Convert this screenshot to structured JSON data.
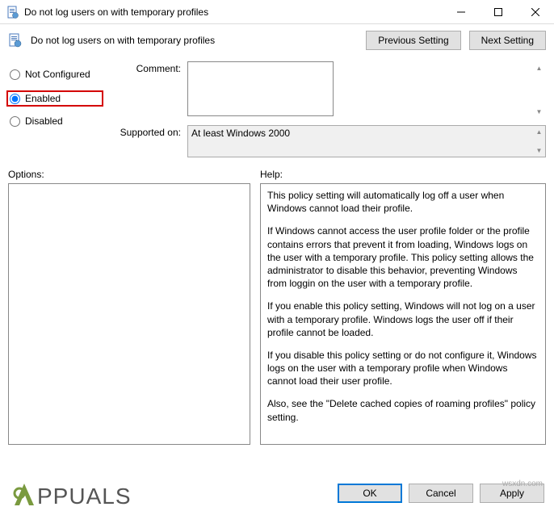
{
  "window": {
    "title": "Do not log users on with temporary profiles"
  },
  "header": {
    "policy_title": "Do not log users on with temporary profiles",
    "previous": "Previous Setting",
    "next": "Next Setting"
  },
  "radios": {
    "not_configured": "Not Configured",
    "enabled": "Enabled",
    "disabled": "Disabled",
    "selected": "enabled"
  },
  "fields": {
    "comment_label": "Comment:",
    "comment_value": "",
    "supported_label": "Supported on:",
    "supported_value": "At least Windows 2000"
  },
  "labels": {
    "options": "Options:",
    "help": "Help:"
  },
  "help": {
    "p1": "This policy setting will automatically log off a user when Windows cannot load their profile.",
    "p2": "If Windows cannot access the user profile folder or the profile contains errors that prevent it from loading, Windows logs on the user with a temporary profile. This policy setting allows the administrator to disable this behavior, preventing Windows from loggin on the user with a temporary profile.",
    "p3": "If you enable this policy setting, Windows will not log on a user with a temporary profile. Windows logs the user off if their profile cannot be loaded.",
    "p4": "If you disable this policy setting or do not configure it, Windows logs on the user with a temporary profile when Windows cannot load their user profile.",
    "p5": "Also, see the \"Delete cached copies of roaming profiles\" policy setting."
  },
  "buttons": {
    "ok": "OK",
    "cancel": "Cancel",
    "apply": "Apply"
  },
  "watermark": {
    "text": "PPUALS",
    "src": "wsxdn.com"
  }
}
